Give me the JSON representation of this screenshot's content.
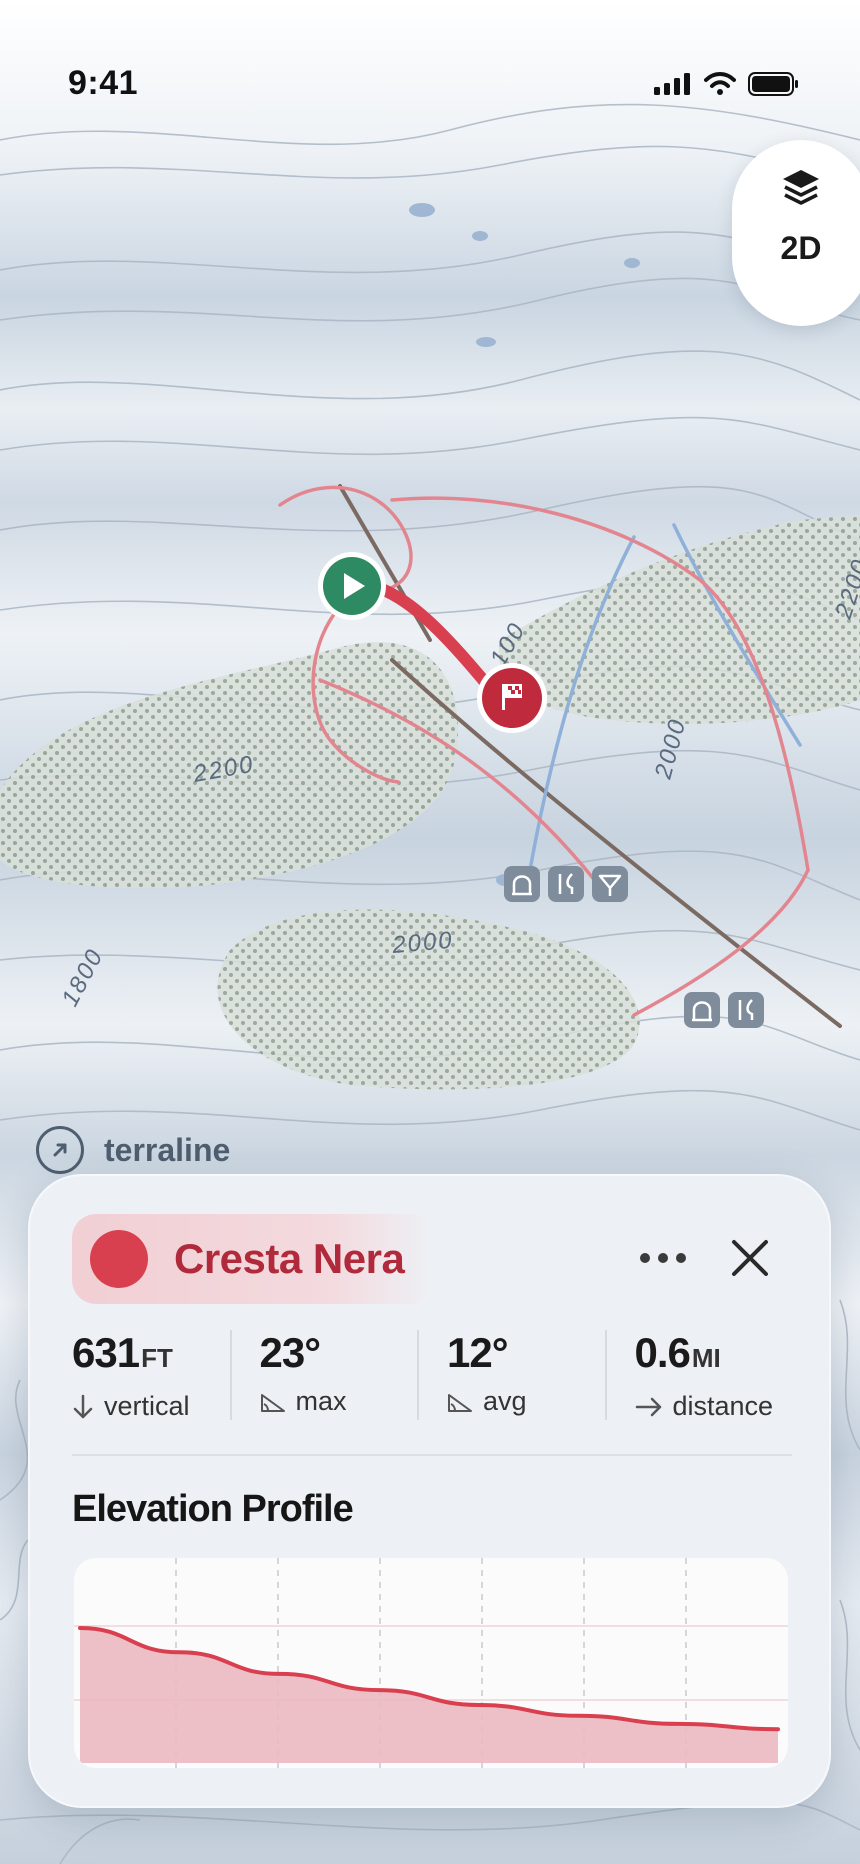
{
  "status_bar": {
    "time": "9:41"
  },
  "map": {
    "contour_labels": [
      "2200",
      "2200",
      "2000",
      "2000",
      "1800",
      "100"
    ],
    "poi_icons": [
      "lodge-icon",
      "restaurant-icon",
      "bar-icon",
      "lodge-icon",
      "restaurant-icon"
    ]
  },
  "layer_control": {
    "icon": "layers-icon",
    "mode_label": "2D"
  },
  "brand": {
    "icon": "compass-arrow-icon",
    "name": "terraline"
  },
  "run_card": {
    "title": "Cresta Nera",
    "color": "#d9404f",
    "stats": [
      {
        "value": "631",
        "unit": "FT",
        "icon": "arrow-down-icon",
        "label": "vertical"
      },
      {
        "value": "23°",
        "unit": "",
        "icon": "slope-icon",
        "label": "max"
      },
      {
        "value": "12°",
        "unit": "",
        "icon": "slope-icon",
        "label": "avg"
      },
      {
        "value": "0.6",
        "unit": "MI",
        "icon": "arrow-right-icon",
        "label": "distance"
      }
    ],
    "profile_title": "Elevation Profile"
  },
  "chart_data": {
    "type": "area",
    "title": "Elevation Profile",
    "xlabel": "",
    "ylabel": "",
    "x": [
      0,
      1,
      2,
      3,
      4,
      5,
      6,
      7
    ],
    "values": [
      100,
      82,
      66,
      54,
      43,
      35,
      29,
      25
    ],
    "ylim": [
      0,
      100
    ],
    "series": [
      {
        "color": "#d9404f"
      }
    ],
    "grid": "dashed vertical"
  }
}
